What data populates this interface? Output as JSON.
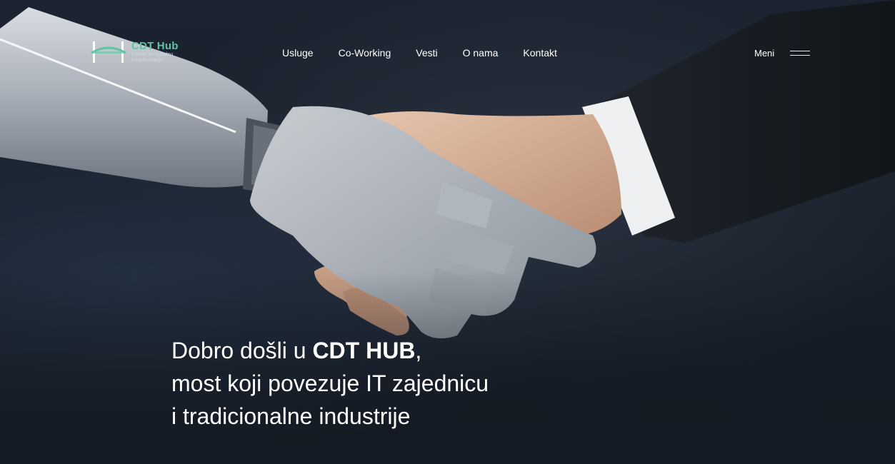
{
  "logo": {
    "title": "CDT Hub",
    "subtitle": "Centar za digitalnu transformaciju",
    "icon": "cdt-hub-logo-icon",
    "accent_color": "#5fc3a4"
  },
  "nav": {
    "items": [
      {
        "label": "Usluge"
      },
      {
        "label": "Co-Working"
      },
      {
        "label": "Vesti"
      },
      {
        "label": "O nama"
      },
      {
        "label": "Kontakt"
      }
    ]
  },
  "menu": {
    "label": "Meni",
    "icon": "hamburger-icon"
  },
  "hero": {
    "image": "robot-human-handshake-image",
    "headline_prefix": "Dobro došli u ",
    "headline_brand": "CDT HUB",
    "headline_suffix": ",",
    "headline_line2": "most koji povezuje IT zajednicu",
    "headline_line3": "i tradicionalne industrije"
  }
}
